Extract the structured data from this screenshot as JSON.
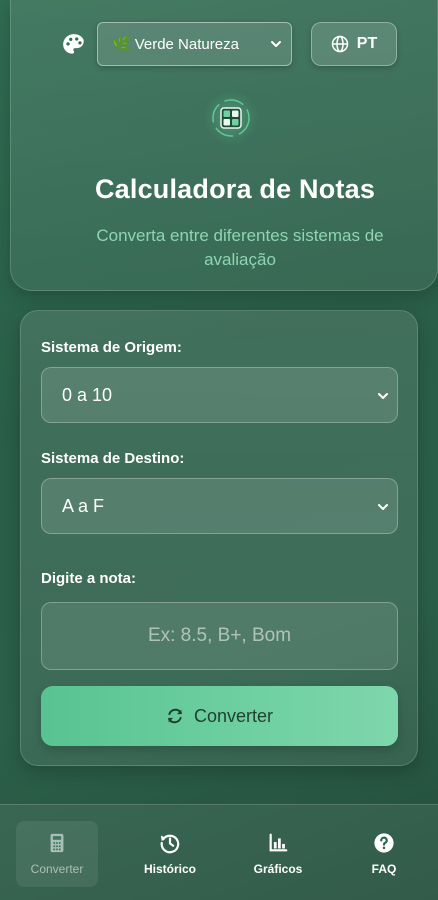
{
  "header": {
    "theme_select": {
      "leaf_glyph": "🌿",
      "label": "Verde Natureza"
    },
    "language_button": {
      "label": "PT"
    },
    "title": "Calculadora de Notas",
    "subtitle": "Converta entre diferentes sistemas de avaliação"
  },
  "form": {
    "source_label": "Sistema de Origem:",
    "source_value": "0 a 10",
    "target_label": "Sistema de Destino:",
    "target_value": "A a F",
    "grade_label": "Digite a nota:",
    "grade_value": "",
    "grade_placeholder": "Ex: 8.5, B+, Bom",
    "convert_label": "Converter"
  },
  "nav": {
    "items": [
      {
        "label": "Converter",
        "icon": "calculator-icon",
        "active": true
      },
      {
        "label": "Histórico",
        "icon": "history-icon",
        "active": false
      },
      {
        "label": "Gráficos",
        "icon": "chart-icon",
        "active": false
      },
      {
        "label": "FAQ",
        "icon": "question-icon",
        "active": false
      }
    ]
  },
  "colors": {
    "background": "#2b5f49",
    "accent": "#6fd0a1",
    "subtitle": "#8fd4b3",
    "button_text": "#1f3f31"
  }
}
